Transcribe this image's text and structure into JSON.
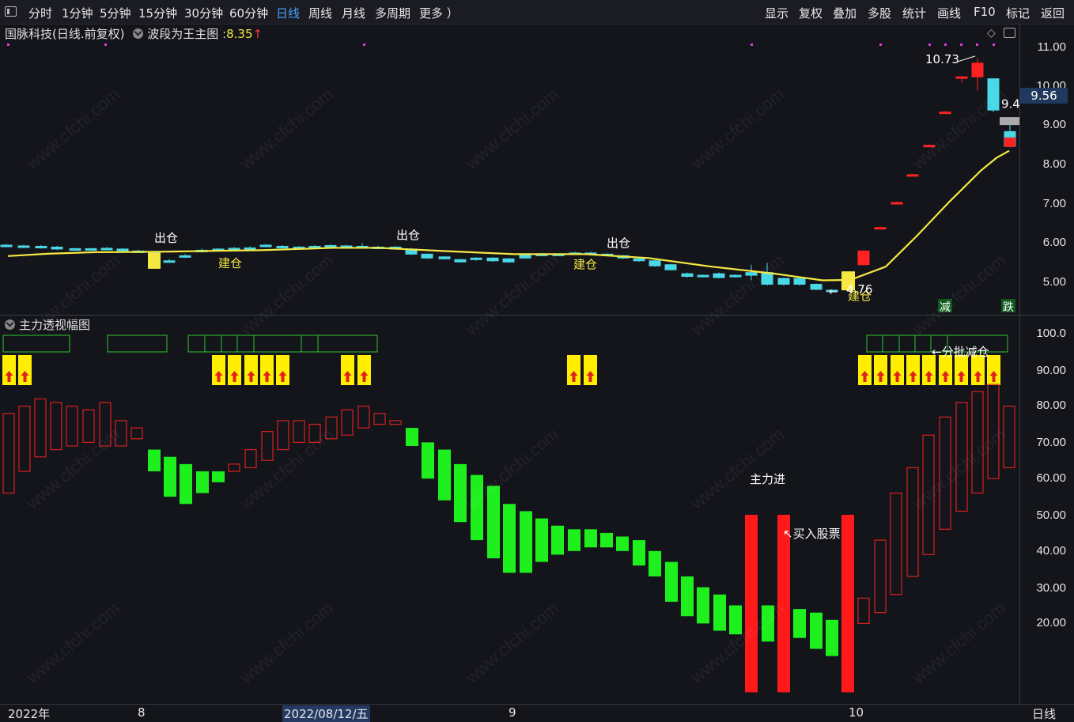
{
  "toolbar": {
    "periods": [
      "分时",
      "1分钟",
      "5分钟",
      "15分钟",
      "30分钟",
      "60分钟",
      "日线",
      "周线",
      "月线",
      "多周期",
      "更多 ）"
    ],
    "active_period": "日线",
    "tools": [
      "显示",
      "复权",
      "叠加",
      "多股",
      "统计",
      "画线",
      "F10",
      "标记",
      "返回"
    ]
  },
  "main_chart": {
    "stock_title": "国脉科技(日线.前复权)",
    "indicator_name": "波段为王主图",
    "indicator_value": "8.35",
    "indicator_arrow": "↑",
    "price_axis": [
      "11.00",
      "10.00",
      "9.00",
      "8.00",
      "7.00",
      "6.00",
      "5.00"
    ],
    "current_price": "9.56",
    "last_close_label": "9.4",
    "high_label": "10.73",
    "low_label": "4.76",
    "signals": [
      {
        "text": "出仓",
        "kind": "exit"
      },
      {
        "text": "建仓",
        "kind": "entry"
      },
      {
        "text": "出仓",
        "kind": "exit"
      },
      {
        "text": "建仓",
        "kind": "entry"
      },
      {
        "text": "出仓",
        "kind": "exit"
      },
      {
        "text": "建仓",
        "kind": "entry"
      }
    ],
    "badges": [
      "减",
      "跌"
    ],
    "colors": {
      "up": "#ff2222",
      "down": "#48d8e6",
      "ma": "#f5e842",
      "signal": "#f5e842",
      "dots": "#e03ce0"
    }
  },
  "sub_chart": {
    "title": "主力透视幅图",
    "axis": [
      "100.0",
      "90.00",
      "80.00",
      "70.00",
      "60.00",
      "50.00",
      "40.00",
      "30.00",
      "20.00"
    ],
    "annotations": {
      "main_force": "主力进",
      "buy": "↖买入股票",
      "reduce": "←分批减仓"
    },
    "colors": {
      "green": "#1ef01e",
      "red": "#ff1a1a",
      "hollow": "#d62020",
      "box": "#2fc42f",
      "arrow_bg": "#ffee00"
    }
  },
  "bottom_axis": {
    "labels": [
      "2022年",
      "8",
      "2022/08/12/五",
      "9",
      "10"
    ],
    "selected": "2022/08/12/五",
    "period_label": "日线"
  },
  "watermark": "www.cfchi.com"
}
